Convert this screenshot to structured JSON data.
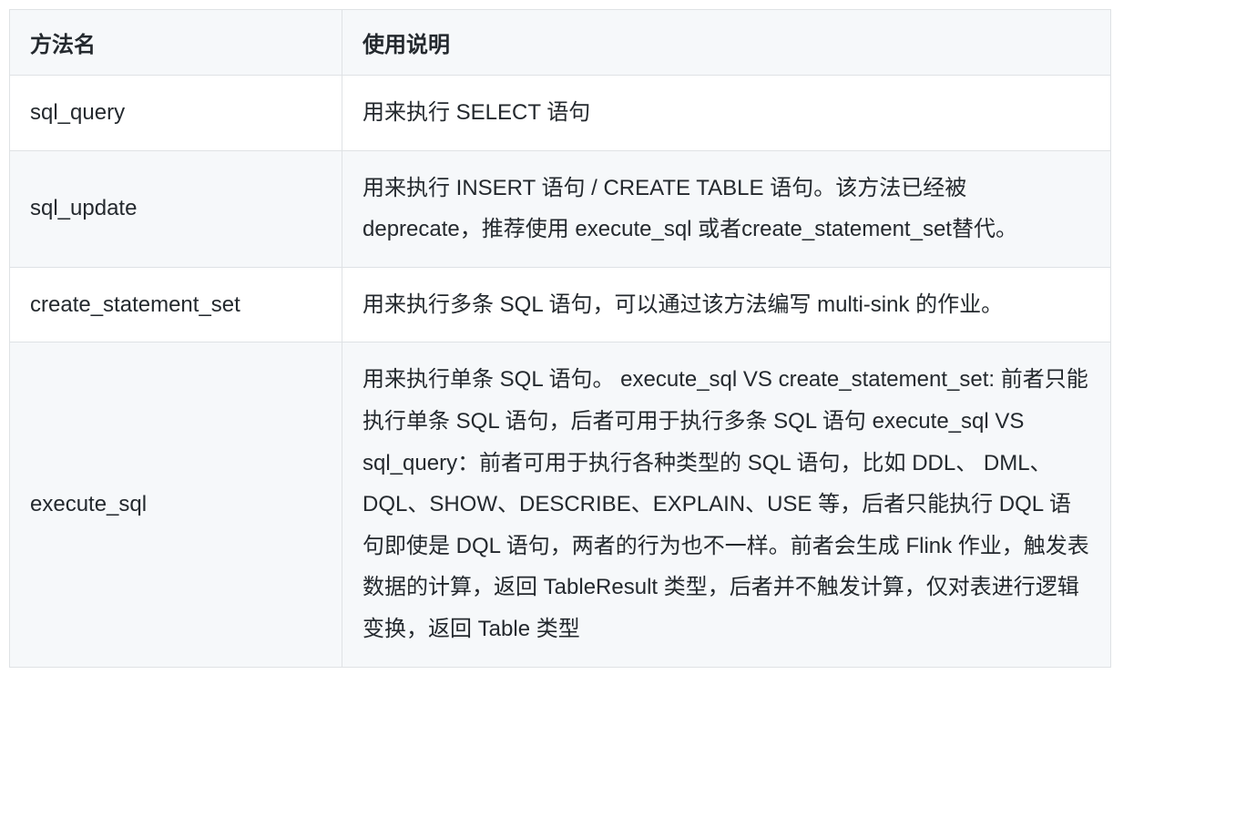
{
  "table": {
    "headers": {
      "method": "方法名",
      "description": "使用说明"
    },
    "rows": [
      {
        "method": "sql_query",
        "description": "用来执行 SELECT 语句"
      },
      {
        "method": "sql_update",
        "description": "用来执行 INSERT 语句 / CREATE TABLE 语句。该方法已经被 deprecate，推荐使用 execute_sql 或者create_statement_set替代。"
      },
      {
        "method": "create_statement_set",
        "description": "用来执行多条 SQL 语句，可以通过该方法编写 multi-sink 的作业。"
      },
      {
        "method": "execute_sql",
        "description": "用来执行单条 SQL 语句。 execute_sql VS create_statement_set: 前者只能执行单条 SQL 语句，后者可用于执行多条 SQL 语句 execute_sql VS sql_query：前者可用于执行各种类型的 SQL 语句，比如 DDL、 DML、DQL、SHOW、DESCRIBE、EXPLAIN、USE 等，后者只能执行 DQL 语句即使是 DQL 语句，两者的行为也不一样。前者会生成 Flink 作业，触发表数据的计算，返回 TableResult 类型，后者并不触发计算，仅对表进行逻辑变换，返回 Table 类型"
      }
    ]
  }
}
